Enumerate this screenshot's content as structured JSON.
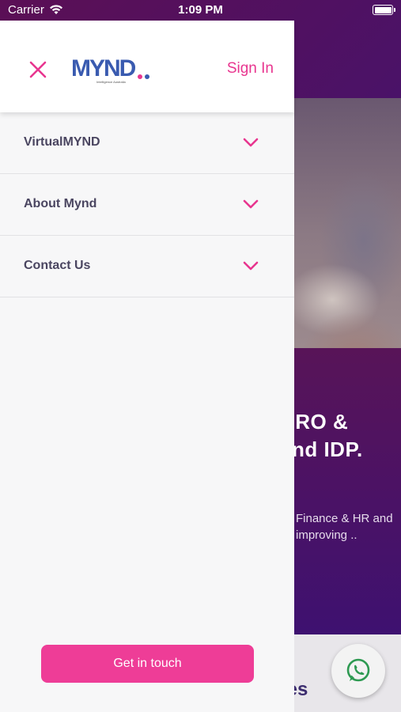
{
  "status_bar": {
    "carrier": "Carrier",
    "time": "1:09 PM"
  },
  "header": {
    "logo_text": "MYND",
    "logo_tagline": "Intelligence Australia",
    "sign_in_label": "Sign In",
    "close_icon": "close-icon"
  },
  "menu": {
    "items": [
      {
        "label": "VirtualMYND",
        "icon": "chevron-down-icon"
      },
      {
        "label": "About Mynd",
        "icon": "chevron-down-icon"
      },
      {
        "label": "Contact Us",
        "icon": "chevron-down-icon"
      }
    ]
  },
  "cta": {
    "label": "Get in touch"
  },
  "background": {
    "hero_line1": "HRO &",
    "hero_line2": "and IDP.",
    "hero_desc": "Finance & HR and improving ..",
    "services_partial": "ies",
    "whatsapp_icon": "whatsapp-icon"
  },
  "colors": {
    "accent": "#ee3d97",
    "brand_blue": "#3a5bb0",
    "background_purple": "#4a1268"
  }
}
